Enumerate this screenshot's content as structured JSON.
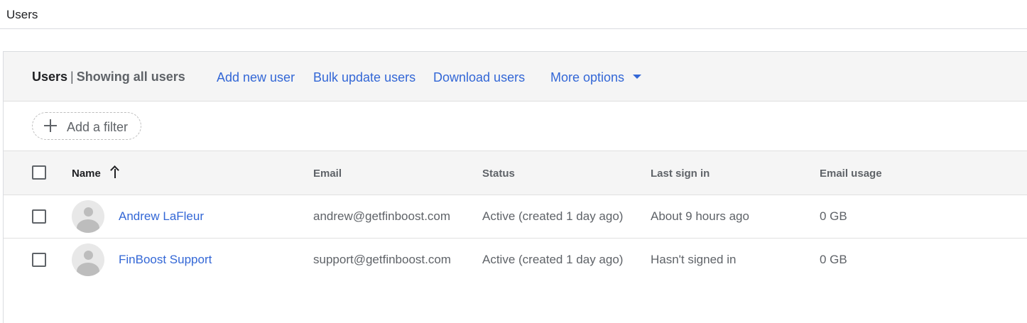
{
  "page": {
    "title": "Users"
  },
  "header": {
    "title": "Users",
    "separator": "|",
    "subtitle": "Showing all users",
    "actions": {
      "add_new_user": "Add new user",
      "bulk_update_users": "Bulk update users",
      "download_users": "Download users",
      "more_options": "More options"
    },
    "more_options_icon": "caret-down-icon"
  },
  "filter": {
    "label": "Add a filter",
    "icon": "plus-icon"
  },
  "table": {
    "columns": {
      "name": "Name",
      "email": "Email",
      "status": "Status",
      "last_sign_in": "Last sign in",
      "email_usage": "Email usage"
    },
    "sort": {
      "column": "Name",
      "direction": "ascending",
      "icon": "arrow-up-icon"
    },
    "rows": [
      {
        "name": "Andrew LaFleur",
        "email": "andrew@getfinboost.com",
        "status": "Active (created 1 day ago)",
        "last_sign_in": "About 9 hours ago",
        "email_usage": "0 GB"
      },
      {
        "name": "FinBoost Support",
        "email": "support@getfinboost.com",
        "status": "Active (created 1 day ago)",
        "last_sign_in": "Hasn't signed in",
        "email_usage": "0 GB"
      }
    ]
  },
  "colors": {
    "link": "#3367d6",
    "header_bg": "#f5f5f5",
    "text_secondary": "#5f6368",
    "divider": "#e0e0e0"
  }
}
